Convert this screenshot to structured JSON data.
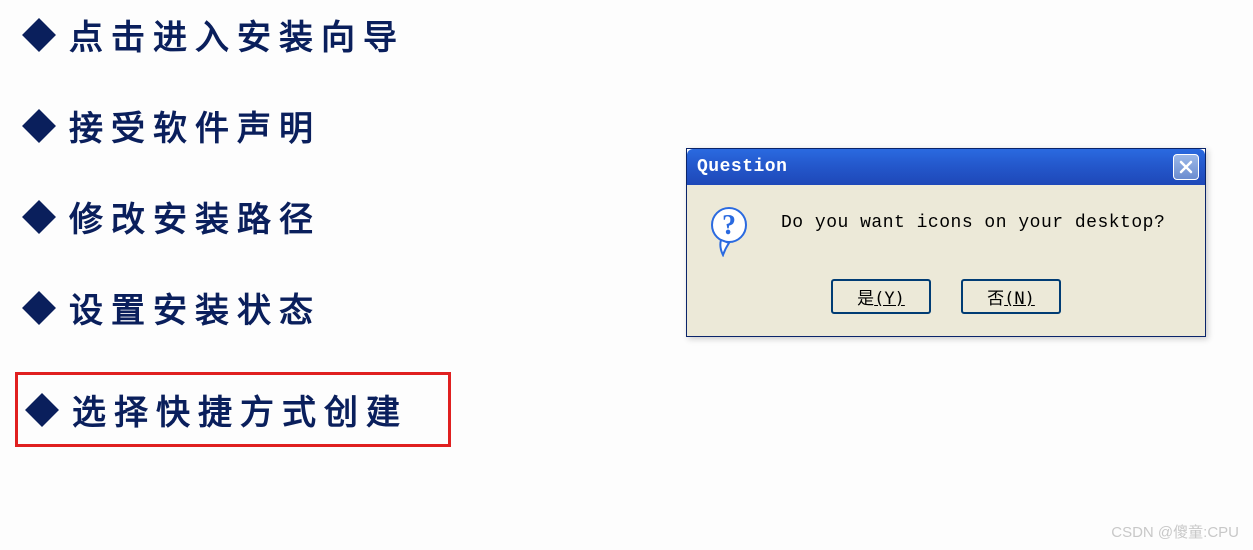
{
  "steps": [
    {
      "label": "点击进入安装向导",
      "highlighted": false
    },
    {
      "label": "接受软件声明",
      "highlighted": false
    },
    {
      "label": "修改安装路径",
      "highlighted": false
    },
    {
      "label": "设置安装状态",
      "highlighted": false
    },
    {
      "label": "选择快捷方式创建",
      "highlighted": true
    }
  ],
  "dialog": {
    "title": "Question",
    "message": "Do you want icons on your desktop?",
    "yes_prefix": "是",
    "yes_key": "(Y)",
    "no_prefix": "否",
    "no_key": "(N)"
  },
  "watermark": "CSDN @傻童:CPU"
}
